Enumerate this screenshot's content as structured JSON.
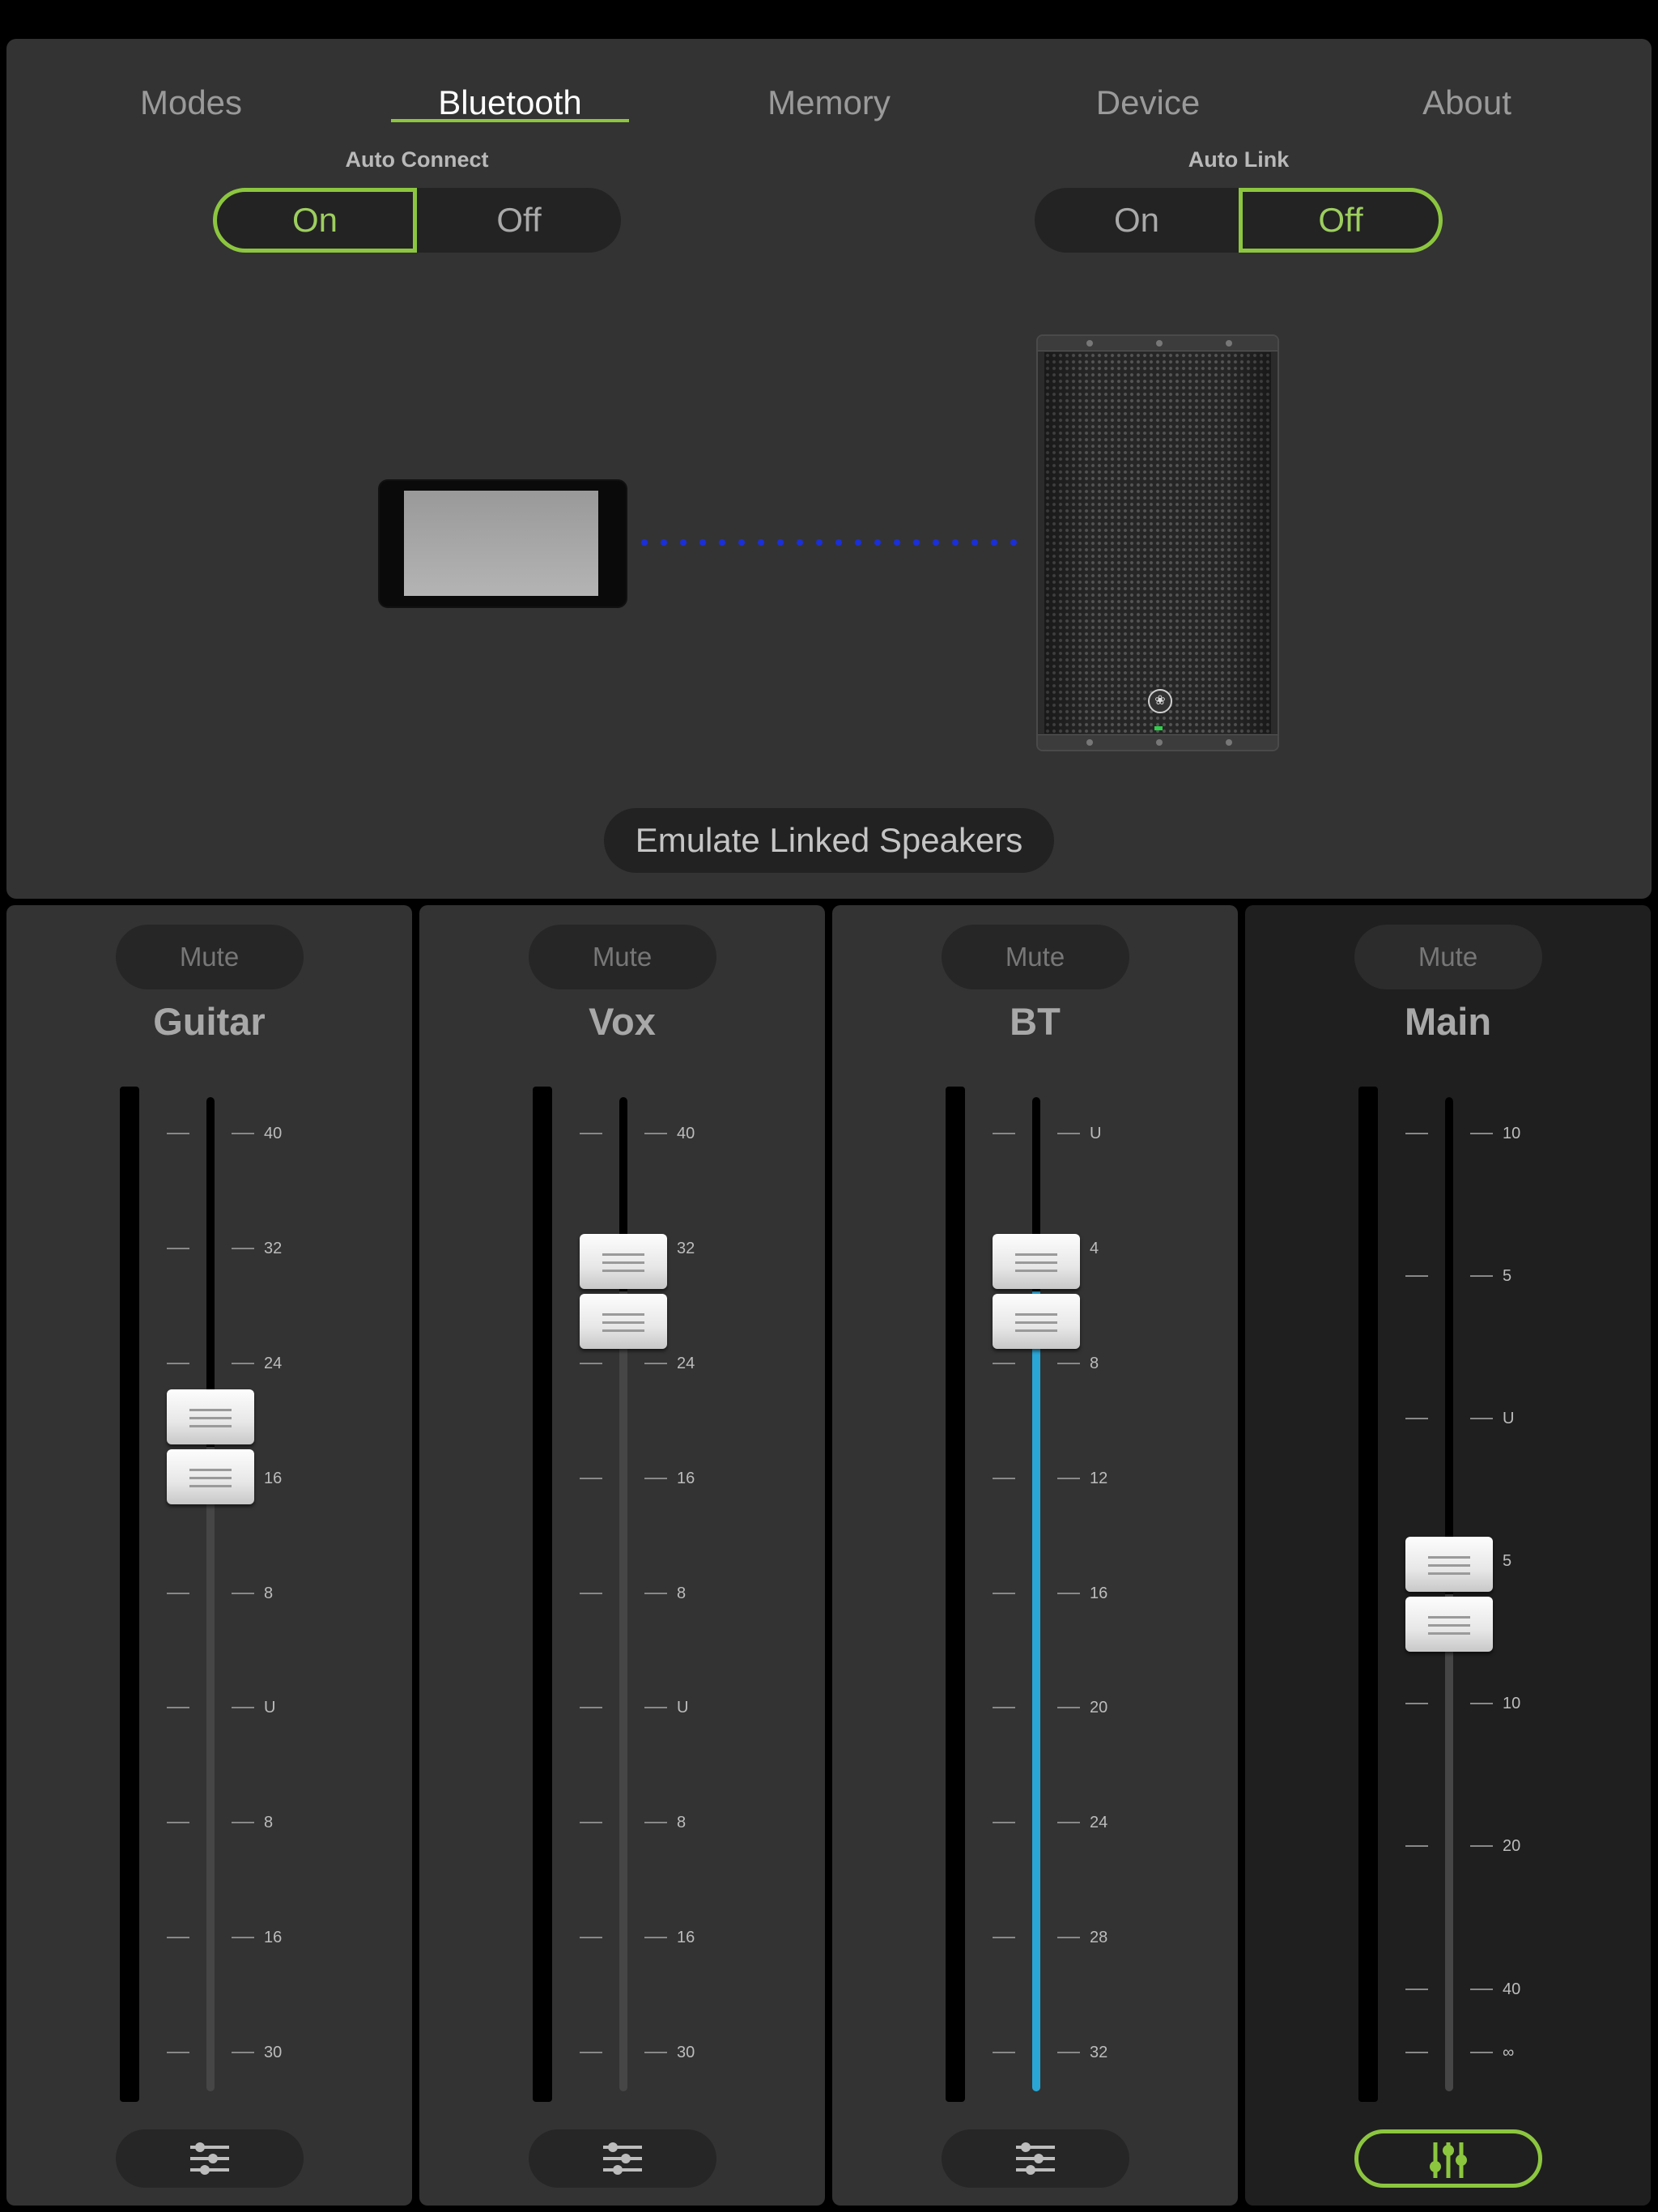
{
  "tabs": [
    {
      "label": "Modes",
      "active": false
    },
    {
      "label": "Bluetooth",
      "active": true
    },
    {
      "label": "Memory",
      "active": false
    },
    {
      "label": "Device",
      "active": false
    },
    {
      "label": "About",
      "active": false
    }
  ],
  "auto_connect": {
    "label": "Auto Connect",
    "on": "On",
    "off": "Off",
    "selected": "On"
  },
  "auto_link": {
    "label": "Auto Link",
    "on": "On",
    "off": "Off",
    "selected": "Off"
  },
  "diagram": {
    "phone_icon": "phone-icon",
    "speaker_icon": "speaker-icon",
    "link_icon": "bluetooth-link-dots",
    "link_color": "#1a2fd8"
  },
  "emulate_button": "Emulate Linked Speakers",
  "colors": {
    "accent": "#8cc63f",
    "meter_blue": "#2aa6d6",
    "panel": "#333333"
  },
  "channels": [
    {
      "name": "Guitar",
      "mute": "Mute",
      "scale": [
        "40",
        "32",
        "24",
        "16",
        "8",
        "U",
        "8",
        "16",
        "30"
      ],
      "level_fraction": 0.67,
      "eq_icon": "sliders-icon",
      "eq_active": false
    },
    {
      "name": "Vox",
      "mute": "Mute",
      "scale": [
        "40",
        "32",
        "24",
        "16",
        "8",
        "U",
        "8",
        "16",
        "30"
      ],
      "level_fraction": 0.85,
      "eq_icon": "sliders-icon",
      "eq_active": false
    },
    {
      "name": "BT",
      "mute": "Mute",
      "scale": [
        "U",
        "4",
        "8",
        "12",
        "16",
        "20",
        "24",
        "28",
        "32"
      ],
      "level_fraction": 0.85,
      "eq_icon": "sliders-icon",
      "eq_active": false
    },
    {
      "name": "Main",
      "mute": "Mute",
      "scale": [
        "10",
        "5",
        "U",
        "5",
        "10",
        "20",
        "40",
        "∞"
      ],
      "level_fraction": 0.5,
      "eq_icon": "mixer-faders-icon",
      "eq_active": true
    }
  ]
}
